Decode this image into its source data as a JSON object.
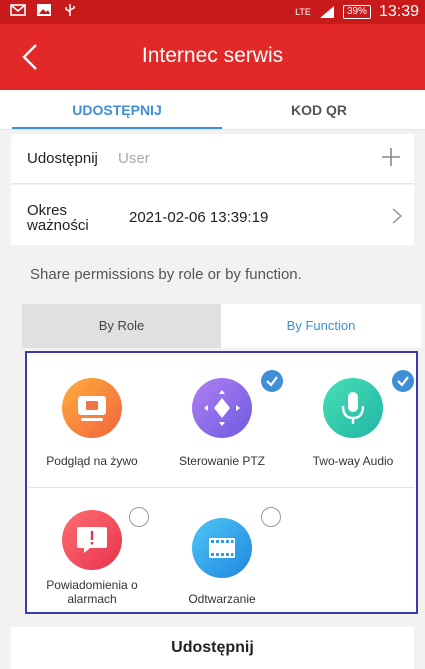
{
  "statusbar": {
    "network": "LTE",
    "battery": "39%",
    "time": "13:39"
  },
  "appbar": {
    "title": "Internec serwis",
    "back_icon": "chevron-left-icon"
  },
  "tabs": [
    {
      "label": "UDOSTĘPNIJ",
      "active": true
    },
    {
      "label": "KOD QR",
      "active": false
    }
  ],
  "share_row": {
    "label": "Udostępnij",
    "placeholder": "User",
    "action_icon": "plus-icon"
  },
  "validity_row": {
    "label": "Okres ważności",
    "value": "2021-02-06 13:39:19"
  },
  "hint": "Share permissions by role or by function.",
  "segment": {
    "options": [
      "By Role",
      "By Function"
    ],
    "selected": "By Function"
  },
  "functions": [
    {
      "label": "Podgląd na żywo",
      "icon": "monitor-icon",
      "checked": null,
      "color": "#f5883c"
    },
    {
      "label": "Sterowanie PTZ",
      "icon": "ptz-direction-icon",
      "checked": true,
      "color": "#8a69e6"
    },
    {
      "label": "Two-way Audio",
      "icon": "microphone-icon",
      "checked": true,
      "color": "#2fc5a8"
    },
    {
      "label": "Powiadomienia o alarmach",
      "icon": "alarm-message-icon",
      "checked": false,
      "color": "#f0424e"
    },
    {
      "label": "Odtwarzanie",
      "icon": "film-icon",
      "checked": false,
      "color": "#2f9be8"
    }
  ],
  "bottom_button": "Udostępnij",
  "colors": {
    "statusbar": "#c81a1a",
    "appbar": "#e32828",
    "accent": "#3e8fd7",
    "highlight_border": "#3b3bb0"
  }
}
